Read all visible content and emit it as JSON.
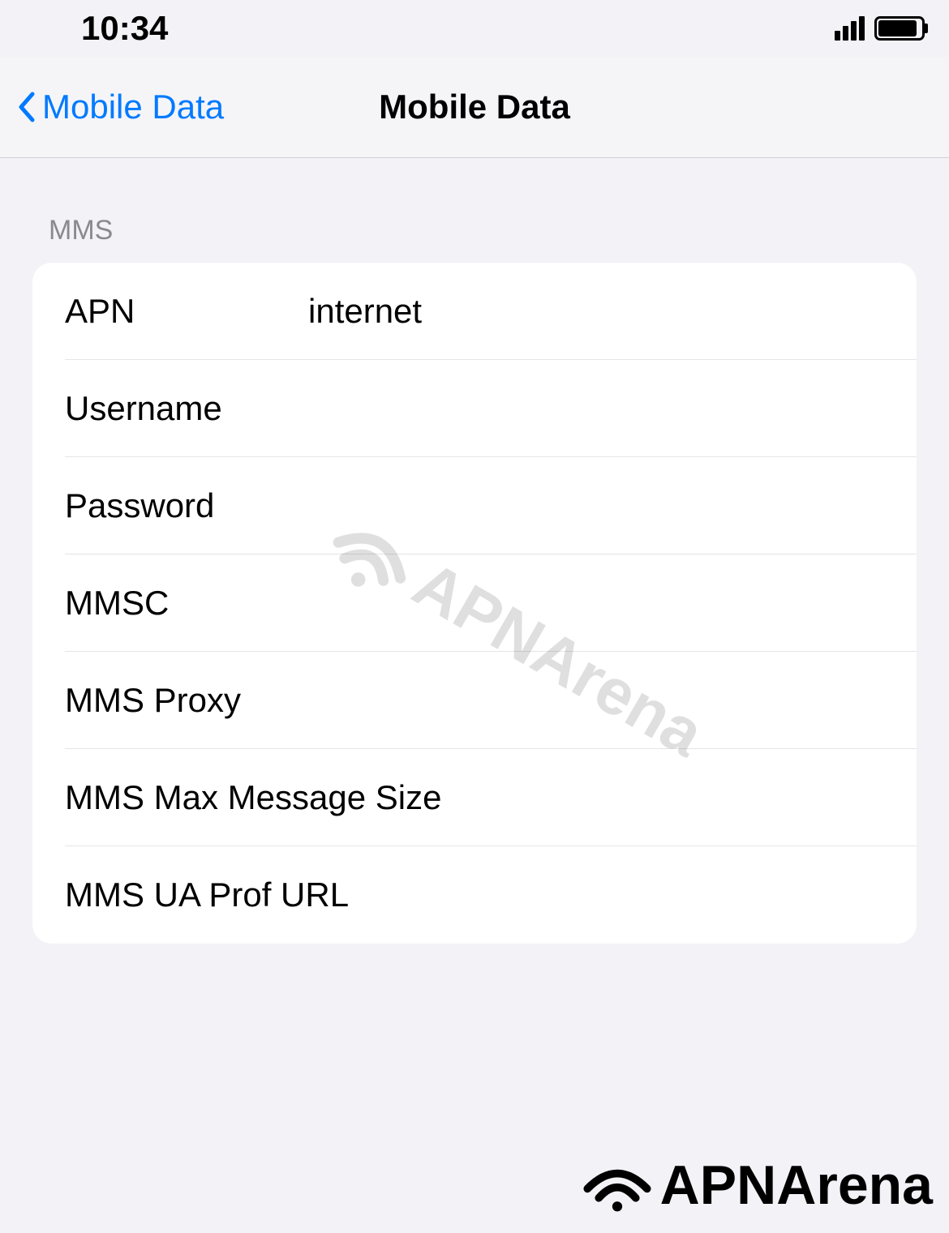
{
  "status_bar": {
    "time": "10:34"
  },
  "nav": {
    "back_label": "Mobile Data",
    "title": "Mobile Data"
  },
  "section": {
    "header": "MMS"
  },
  "fields": {
    "apn": {
      "label": "APN",
      "value": "internet"
    },
    "username": {
      "label": "Username",
      "value": ""
    },
    "password": {
      "label": "Password",
      "value": ""
    },
    "mmsc": {
      "label": "MMSC",
      "value": ""
    },
    "mms_proxy": {
      "label": "MMS Proxy",
      "value": ""
    },
    "mms_max_size": {
      "label": "MMS Max Message Size",
      "value": ""
    },
    "mms_ua_prof": {
      "label": "MMS UA Prof URL",
      "value": ""
    }
  },
  "watermark": {
    "text": "APNArena"
  },
  "footer_logo": {
    "text": "APNArena"
  }
}
